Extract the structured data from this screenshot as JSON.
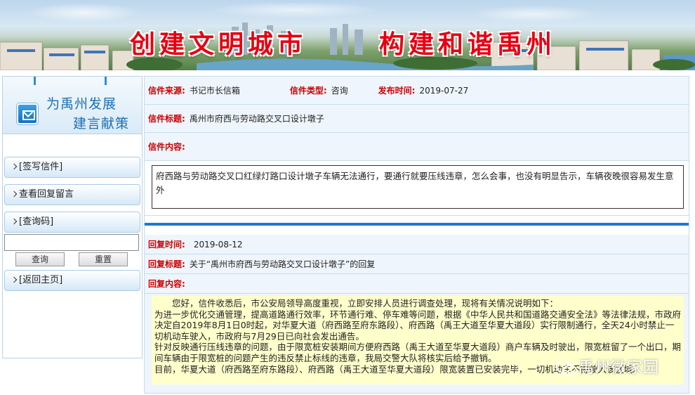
{
  "banner": {
    "title_left": "创建文明城市",
    "title_right": "构建和谐禹州"
  },
  "sidebar": {
    "promo_line1": "为禹州发展",
    "promo_line2": "建言献策",
    "nav": [
      {
        "label": "[签写信件]"
      },
      {
        "label": "查看回复留言"
      },
      {
        "label": "[查询码]"
      },
      {
        "label": "[返回主页]"
      }
    ],
    "query_button": "查询",
    "reset_button": "重置",
    "query_input_value": ""
  },
  "letter": {
    "source_label": "信件来源:",
    "source_value": "书记市长信箱",
    "type_label": "信件类型:",
    "type_value": "咨询",
    "date_label": "发布时间:",
    "date_value": "2019-07-27",
    "title_label": "信件标题:",
    "title_value": "禹州市府西与劳动路交叉口设计墩子",
    "content_label": "信件内容:",
    "content_value": "府西路与劳动路交叉口红绿灯路口设计墩子车辆无法通行，要通行就要压线违章，怎么会事，也没有明显告示，车辆夜晚很容易发生意外"
  },
  "reply": {
    "time_label": "回复时间:",
    "time_value": "2019-08-12",
    "title_label": "回复标题:",
    "title_value": "关于“禹州市府西与劳动路交叉口设计墩子”的回复",
    "content_label": "回复内容:",
    "paragraphs": [
      "您好，信件收悉后，市公安局领导高度重视，立即安排人员进行调查处理，现将有关情况说明如下：",
      "为进一步优化交通管理，提高道路通行效率，环节通行难、停车难等问题，根据《中华人民共和国道路交通安全法》等法律法规，市政府决定自2019年8月1日0时起，对华夏大道（府西路至府东路段）、府西路（禹王大道至华夏大道段）实行限制通行，全天24小时禁止一切机动车驶入，市政府与7月29日已向社会发出通告。",
      "针对反映通行压线违章的问题，由于限宽桩安装期间方便府西路（禹王大道至华夏大道段）商户车辆及时驶出，限宽桩留了一个出口，期间车辆由于限宽桩的问题产生的违反禁止标线的违章，我局交警大队将核实后给予撤销。",
      "目前，华夏大道（府西路至府东路段）、府西路（禹王大道至华夏大道段）限宽装置已安装完毕，一切机动车不得驶入该区域。"
    ]
  },
  "watermark": "禹州微家园",
  "colors": {
    "label_red": "#cc0000",
    "row_bg": "#eef5fc",
    "divider_blue": "#1e78d7",
    "reply_bg": "#ffffcc",
    "banner_title_red": "#e60012"
  }
}
